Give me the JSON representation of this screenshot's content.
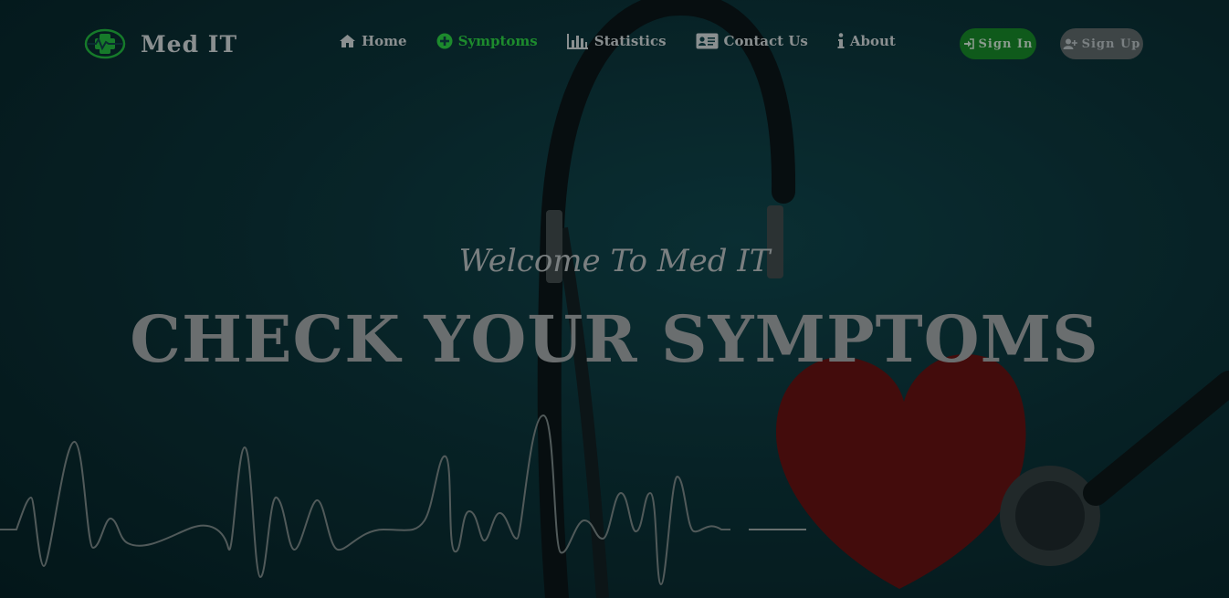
{
  "brand": {
    "name": "Med IT",
    "logo_icon": "medical-cross-heartbeat-icon"
  },
  "nav": {
    "items": [
      {
        "label": "Home",
        "icon": "home-icon",
        "active": false
      },
      {
        "label": "Symptoms",
        "icon": "plus-circle-icon",
        "active": true
      },
      {
        "label": "Statistics",
        "icon": "bar-chart-icon",
        "active": false
      },
      {
        "label": "Contact Us",
        "icon": "id-card-icon",
        "active": false
      },
      {
        "label": "About",
        "icon": "info-icon",
        "active": false
      }
    ],
    "signin_label": "Sign In",
    "signup_label": "Sign Up"
  },
  "hero": {
    "welcome": "Welcome To Med IT",
    "title": "CHECK YOUR SYMPTOMS"
  },
  "colors": {
    "accent": "#1d8a2d",
    "signin_bg": "#0f5a1b",
    "signup_bg": "#3e4546",
    "text_muted": "#8a8f90"
  }
}
